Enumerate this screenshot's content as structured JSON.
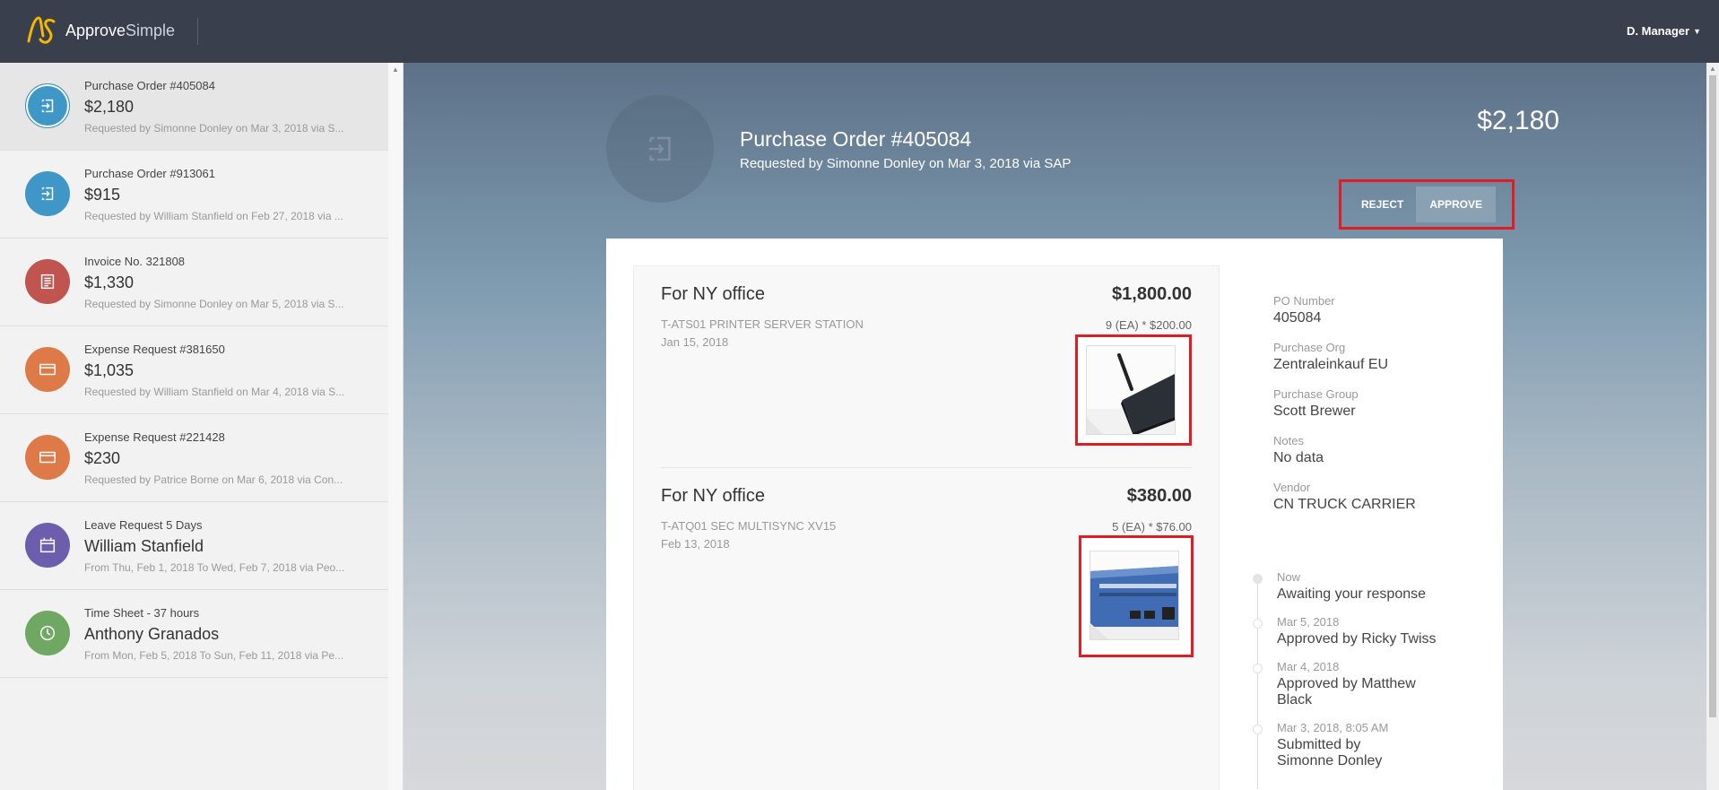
{
  "app": {
    "brand_bold": "Approve",
    "brand_light": "Simple",
    "user": "D. Manager"
  },
  "sidebar": {
    "items": [
      {
        "type": "Purchase Order #405084",
        "amount": "$2,180",
        "meta": "Requested by Simonne Donley on Mar 3, 2018 via S...",
        "icon": "sign-in-icon",
        "color": "#3f97c8",
        "active": true
      },
      {
        "type": "Purchase Order #913061",
        "amount": "$915",
        "meta": "Requested by William Stanfield on Feb 27, 2018 via ...",
        "icon": "sign-in-icon",
        "color": "#3f97c8",
        "active": false
      },
      {
        "type": "Invoice No. 321808",
        "amount": "$1,330",
        "meta": "Requested by Simonne Donley on Mar 5, 2018 via S...",
        "icon": "receipt-icon",
        "color": "#c0544f",
        "active": false
      },
      {
        "type": "Expense Request #381650",
        "amount": "$1,035",
        "meta": "Requested by William Stanfield on Mar 4, 2018 via S...",
        "icon": "credit-card-icon",
        "color": "#dd7a47",
        "active": false
      },
      {
        "type": "Expense Request #221428",
        "amount": "$230",
        "meta": "Requested by Patrice Borne on Mar 6, 2018 via Con...",
        "icon": "credit-card-icon",
        "color": "#dd7a47",
        "active": false
      },
      {
        "type": "Leave Request 5 Days",
        "amount": "William Stanfield",
        "meta": "From Thu, Feb 1, 2018 To Wed, Feb 7, 2018 via Peo...",
        "icon": "calendar-icon",
        "color": "#6c5eac",
        "active": false
      },
      {
        "type": "Time Sheet - 37 hours",
        "amount": "Anthony Granados",
        "meta": "From Mon, Feb 5, 2018 To Sun, Feb 11, 2018 via Pe...",
        "icon": "clock-icon",
        "color": "#6fa862",
        "active": false
      }
    ]
  },
  "detail": {
    "title": "Purchase Order #405084",
    "subtitle": "Requested by Simonne Donley on Mar 3, 2018 via SAP",
    "amount": "$2,180",
    "reject_label": "REJECT",
    "approve_label": "APPROVE",
    "lines": [
      {
        "title": "For NY office",
        "total": "$1,800.00",
        "description": "T-ATS01 PRINTER SERVER STATION",
        "date": "Jan 15, 2018",
        "qty": "9 (EA) * $200.00"
      },
      {
        "title": "For NY office",
        "total": "$380.00",
        "description": "T-ATQ01 SEC MULTISYNC XV15",
        "date": "Feb 13, 2018",
        "qty": "5 (EA) * $76.00"
      }
    ],
    "fields": [
      {
        "label": "PO Number",
        "value": "405084"
      },
      {
        "label": "Purchase Org",
        "value": "Zentraleinkauf EU"
      },
      {
        "label": "Purchase Group",
        "value": "Scott Brewer"
      },
      {
        "label": "Notes",
        "value": "No data"
      },
      {
        "label": "Vendor",
        "value": "CN TRUCK CARRIER"
      }
    ],
    "timeline": [
      {
        "date": "Now",
        "text": "Awaiting your response"
      },
      {
        "date": "Mar 5, 2018",
        "text": "Approved by Ricky Twiss"
      },
      {
        "date": "Mar 4, 2018",
        "text": "Approved by Matthew Black"
      },
      {
        "date": "Mar 3, 2018, 8:05 AM",
        "text": "Submitted by Simonne Donley"
      }
    ]
  }
}
